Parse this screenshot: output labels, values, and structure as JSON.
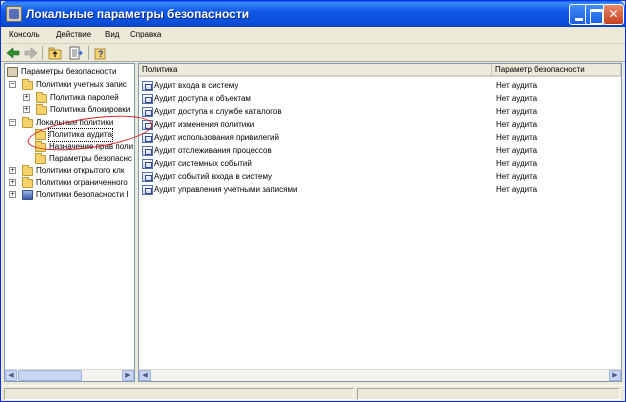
{
  "window": {
    "title": "Локальные параметры безопасности"
  },
  "menu": [
    "Консоль",
    "Действие",
    "Вид",
    "Справка"
  ],
  "toolbar": {
    "icons": [
      "back-icon",
      "forward-icon",
      "up-folder-icon",
      "export-list-icon",
      "help-icon"
    ]
  },
  "tree": {
    "root": "Параметры безопасности",
    "nodes": [
      {
        "label": "Политики учетных запис",
        "expanded": true
      },
      {
        "label": "Политика паролей",
        "expanded": false
      },
      {
        "label": "Политика блокировки",
        "expanded": false
      },
      {
        "label": "Локальные политики",
        "expanded": true
      },
      {
        "label": "Политика аудита",
        "selected": true
      },
      {
        "label": "Назначение прав поли"
      },
      {
        "label": "Параметры безопаснс"
      },
      {
        "label": "Политики открытого клк",
        "expanded": false
      },
      {
        "label": "Политики ограниченного",
        "expanded": false
      },
      {
        "label": "Политики безопасности I",
        "expanded": false
      }
    ]
  },
  "list": {
    "columns": [
      "Политика",
      "Параметр безопасности"
    ],
    "rows": [
      {
        "policy": "Аудит входа в систему",
        "setting": "Нет аудита"
      },
      {
        "policy": "Аудит доступа к объектам",
        "setting": "Нет аудита"
      },
      {
        "policy": "Аудит доступа к службе каталогов",
        "setting": "Нет аудита"
      },
      {
        "policy": "Аудит изменения политики",
        "setting": "Нет аудита"
      },
      {
        "policy": "Аудит использования привилегий",
        "setting": "Нет аудита"
      },
      {
        "policy": "Аудит отслеживания процессов",
        "setting": "Нет аудита"
      },
      {
        "policy": "Аудит системных событий",
        "setting": "Нет аудита"
      },
      {
        "policy": "Аудит событий входа в систему",
        "setting": "Нет аудита"
      },
      {
        "policy": "Аудит управления учетными записями",
        "setting": "Нет аудита"
      }
    ]
  },
  "colors": {
    "title_bar": "#0a4ed8",
    "annotation": "#d42020"
  }
}
